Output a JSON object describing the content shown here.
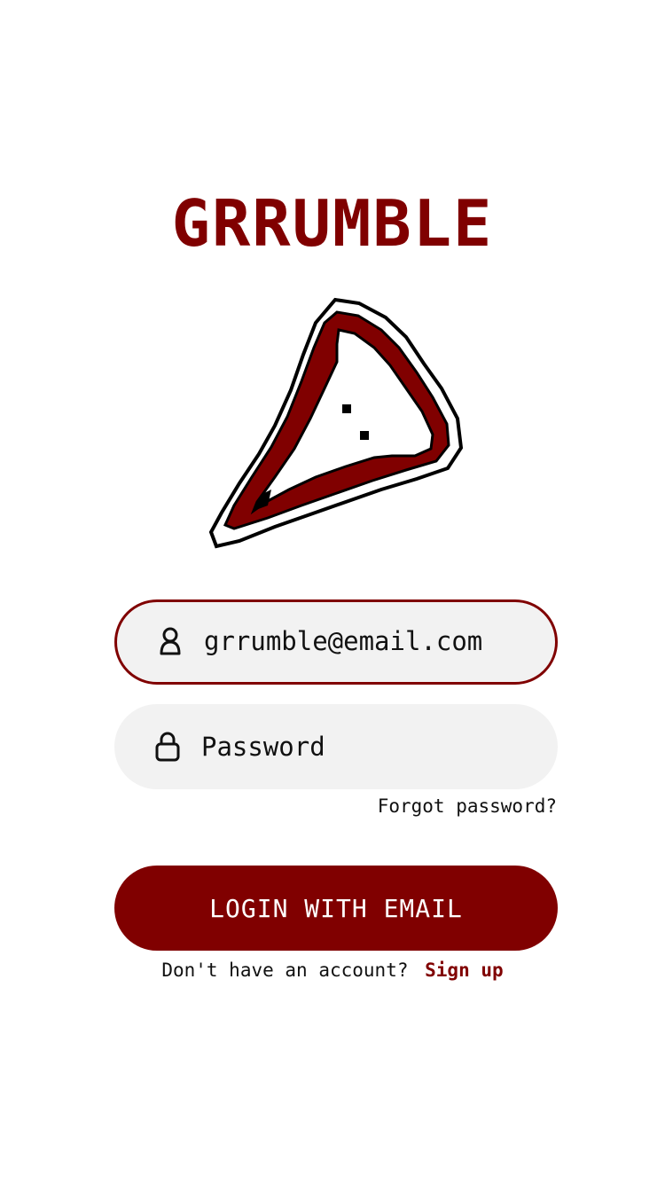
{
  "app": {
    "title": "GRRUMBLE",
    "accent_color": "#800000",
    "logo_icon": "pizza-slice-icon"
  },
  "login_form": {
    "email_icon": "user-icon",
    "email_value": "grrumble@email.com",
    "password_icon": "lock-icon",
    "password_placeholder": "Password",
    "forgot_password_label": "Forgot password?",
    "login_button_label": "LOGIN WITH EMAIL"
  },
  "footer": {
    "signup_prompt": "Don't have an account?",
    "signup_link_label": "Sign up"
  }
}
